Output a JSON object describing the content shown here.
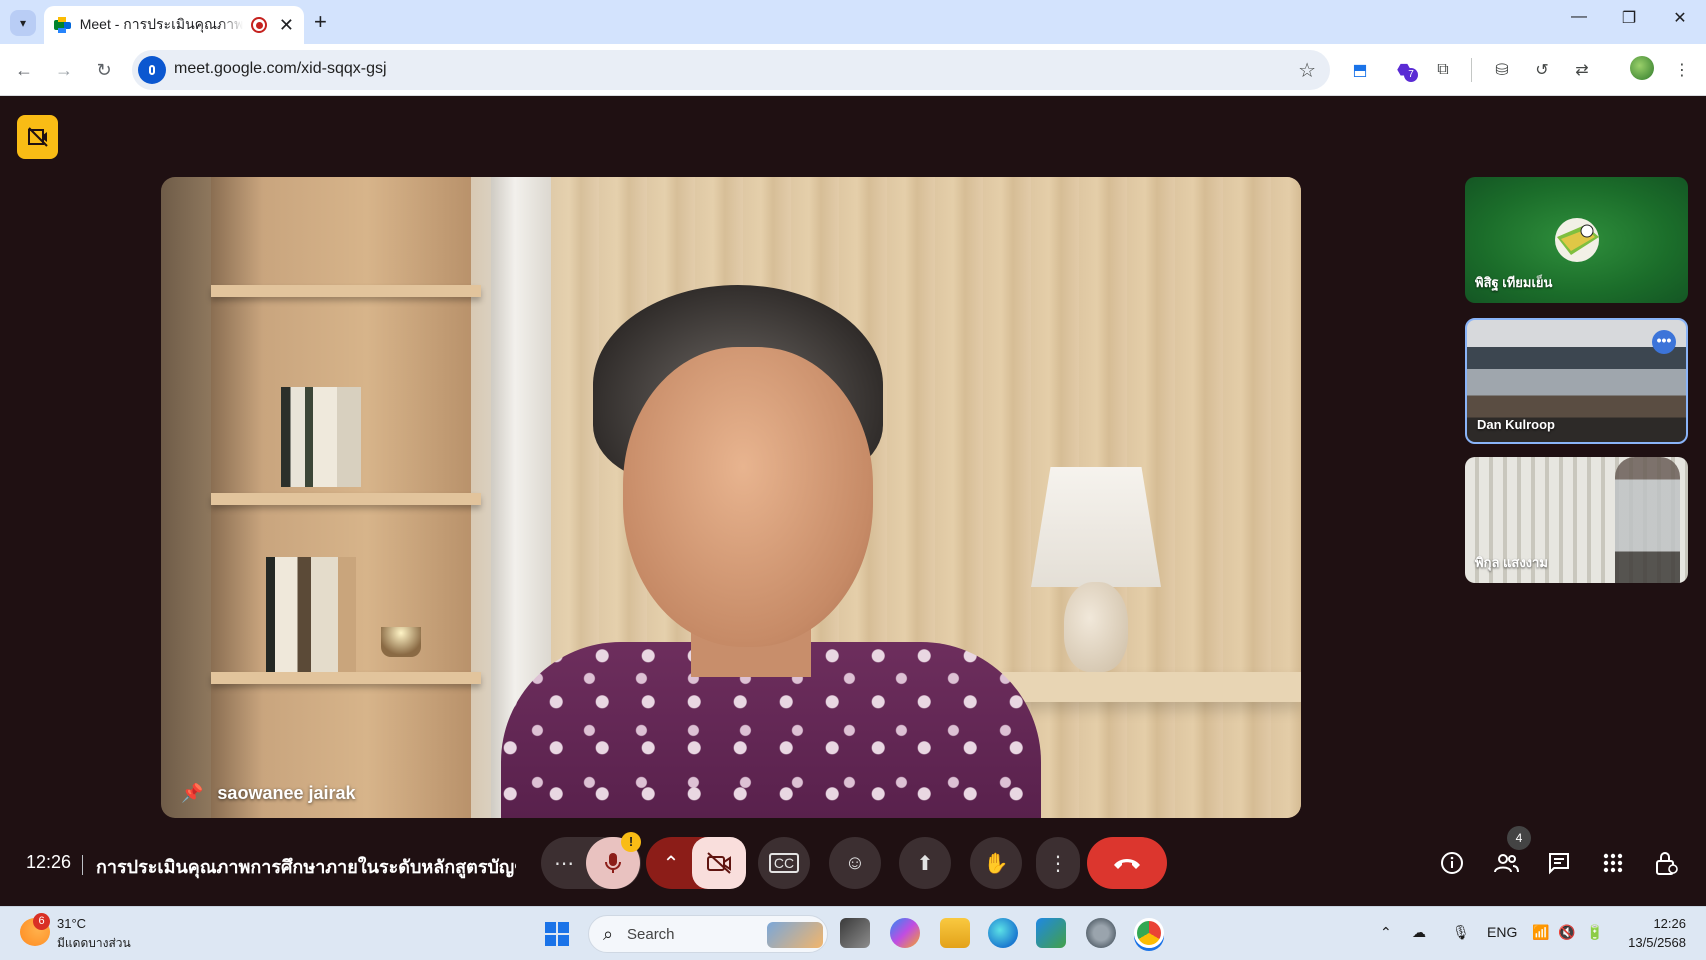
{
  "browser": {
    "tab_title": "Meet - การประเมินคุณภาพการศึกษา",
    "url": "meet.google.com/xid-sqqx-gsj",
    "extension_badge": "7"
  },
  "meet": {
    "main_participant": "saowanee jairak",
    "side_tiles": [
      {
        "name": "พิสิฐ เทียมเย็น"
      },
      {
        "name": "Dan Kulroop"
      },
      {
        "name": "พิกุล แสงงาม"
      }
    ],
    "clock": "12:26",
    "meeting_title": "การประเมินคุณภาพการศึกษาภายในระดับหลักสูตรบัญชีบั...",
    "people_count": "4",
    "mic_warning": "!",
    "colors": {
      "hangup": "#dc362e",
      "camera_off_bg": "#f9dedc",
      "mic_bg": "#e9c2c0",
      "pin_indicator": "#f9bc15",
      "stage_bg": "#1f1012"
    }
  },
  "taskbar": {
    "weather_badge": "6",
    "temperature": "31°C",
    "weather_desc": "มีแดดบางส่วน",
    "search_label": "Search",
    "language": "ENG",
    "time": "12:26",
    "date": "13/5/2568"
  }
}
